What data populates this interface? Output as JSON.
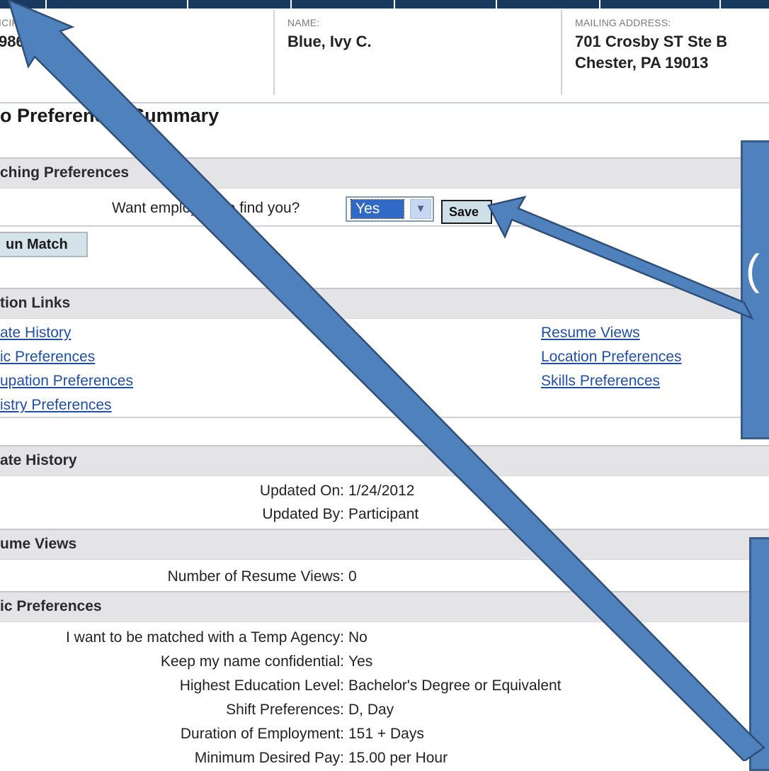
{
  "header": {
    "participant_id_label": "ICIPANT ID:",
    "participant_id_value": "9867",
    "name_label": "NAME:",
    "name_value": "Blue, Ivy C.",
    "address_label": "MAILING ADDRESS:",
    "address_line1": "701 Crosby ST Ste B",
    "address_line2": "Chester, PA 19013"
  },
  "page_title": "o Preferences Summary",
  "matching": {
    "heading": "ching Preferences",
    "question": "Want employers to find you?",
    "selected": "Yes",
    "save_label": "Save",
    "run_match_label": "un Match"
  },
  "links": {
    "heading": "tion Links",
    "left": [
      "ate History",
      "ic Preferences",
      "upation Preferences",
      "istry Preferences"
    ],
    "right": [
      "Resume Views",
      "Location Preferences",
      "Skills Preferences"
    ]
  },
  "update_history": {
    "heading": "ate History",
    "updated_on_label": "Updated On:",
    "updated_on_value": "1/24/2012",
    "updated_by_label": "Updated By:",
    "updated_by_value": "Participant"
  },
  "resume_views": {
    "heading": "ume Views",
    "count_label": "Number of Resume Views:",
    "count_value": "0"
  },
  "basic_preferences": {
    "heading": "ic Preferences",
    "rows": [
      {
        "label": "I want to be matched with a Temp Agency:",
        "value": "No"
      },
      {
        "label": "Keep my name confidential:",
        "value": "Yes"
      },
      {
        "label": "Highest Education Level:",
        "value": "Bachelor's Degree or Equivalent"
      },
      {
        "label": "Shift Preferences:",
        "value": "D, Day"
      },
      {
        "label": "Duration of Employment:",
        "value": "151 + Days"
      },
      {
        "label": "Minimum Desired Pay:",
        "value": "15.00 per Hour"
      }
    ]
  },
  "annotations": {
    "callout_top_glyph": "(",
    "callout_color": "#4f81bd",
    "arrow_color": "#4f81bd",
    "header_bar_color": "#173a5e"
  }
}
